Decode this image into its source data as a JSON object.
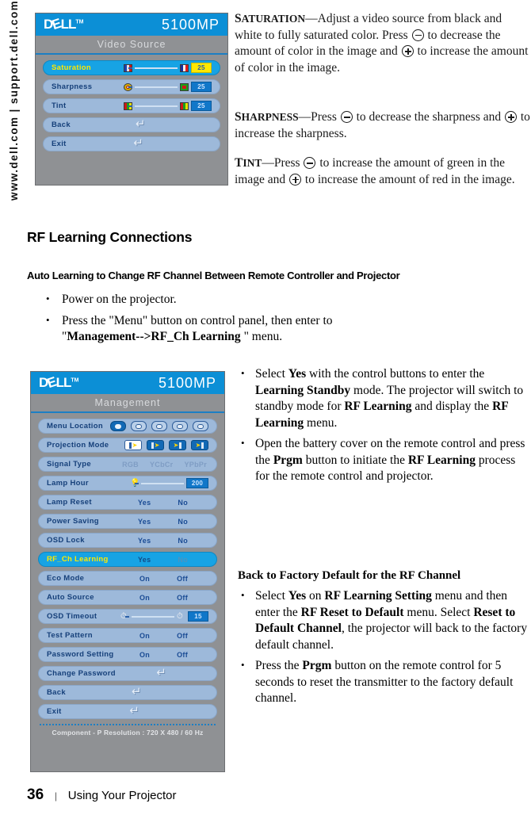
{
  "sidebar": {
    "url_text": "www.dell.com | support.dell.com"
  },
  "video_osd": {
    "brand": "DELL",
    "brand_tm": "TM",
    "model": "5100MP",
    "title": "Video  Source",
    "rows": [
      {
        "label": "Saturation",
        "value": "25",
        "selected": true
      },
      {
        "label": "Sharpness",
        "value": "25",
        "selected": false
      },
      {
        "label": "Tint",
        "value": "25",
        "selected": false
      },
      {
        "label": "Back",
        "selected": false
      },
      {
        "label": "Exit",
        "selected": false
      }
    ]
  },
  "management_osd": {
    "brand": "DELL",
    "brand_tm": "TM",
    "model": "5100MP",
    "title": "Management",
    "rows": [
      {
        "label": "Menu Location"
      },
      {
        "label": "Projection Mode"
      },
      {
        "label": "Signal Type",
        "options": [
          "RGB",
          "YCbCr",
          "YPbPr"
        ]
      },
      {
        "label": "Lamp Hour",
        "value": "200"
      },
      {
        "label": "Lamp Reset",
        "options": [
          "Yes",
          "No"
        ]
      },
      {
        "label": "Power Saving",
        "options": [
          "Yes",
          "No"
        ]
      },
      {
        "label": "OSD Lock",
        "options": [
          "Yes",
          "No"
        ]
      },
      {
        "label": "RF_Ch Learning",
        "options": [
          "Yes",
          "No"
        ],
        "selected": true
      },
      {
        "label": "Eco Mode",
        "options": [
          "On",
          "Off"
        ]
      },
      {
        "label": "Auto Source",
        "options": [
          "On",
          "Off"
        ]
      },
      {
        "label": "OSD Timeout",
        "value": "15"
      },
      {
        "label": "Test Pattern",
        "options": [
          "On",
          "Off"
        ]
      },
      {
        "label": "Password Setting",
        "options": [
          "On",
          "Off"
        ]
      },
      {
        "label": "Change Password"
      },
      {
        "label": "Back"
      },
      {
        "label": "Exit"
      }
    ],
    "status": "Component - P Resolution : 720 X 480 / 60 Hz"
  },
  "text": {
    "saturation_term": "S",
    "saturation_term_rest": "ATURATION",
    "saturation_p1": "—Adjust a video source from black and white to fully saturated color. Press ",
    "saturation_p2": " to decrease the amount of color in the image and ",
    "saturation_p3": " to increase the amount of color in the image.",
    "sharpness_term": "S",
    "sharpness_term_rest": "HARPNESS",
    "sharpness_p1": "—Press ",
    "sharpness_p2": " to decrease the sharpness and ",
    "sharpness_p3": " to increase the sharpness.",
    "tint_term": "T",
    "tint_term_rest": "INT",
    "tint_p1": "—Press ",
    "tint_p2": " to increase the amount of green in the image and ",
    "tint_p3": " to increase the amount of red in the image."
  },
  "section": {
    "heading": "RF Learning Connections",
    "subheading": "Auto Learning to Change RF Channel  Between Remote Controller and Projector",
    "bullets": [
      "Power on the projector.",
      "Press the \"Menu\" button on control panel, then enter to"
    ],
    "bullet2_line2_pre": "\"",
    "bullet2_line2_bold": "Management-->RF_Ch Learning",
    "bullet2_line2_post": " \" menu."
  },
  "right_list": {
    "b1_p1": "Select ",
    "b1_b1": "Yes",
    "b1_p2": " with the control buttons to enter the ",
    "b1_b2": "Learning Standby",
    "b1_p3": " mode. The projector will switch to standby mode for ",
    "b1_b3": "RF Learning",
    "b1_p4": " and display the ",
    "b1_b4": "RF Learning",
    "b1_p5": " menu.",
    "b2_p1": "Open the battery cover on the remote control and press the ",
    "b2_b1": "Prgm",
    "b2_p2": " button to initiate the ",
    "b2_b2": "RF Learning",
    "b2_p3": " process for the remote control and projector.",
    "factory_heading": "Back to Factory Default for the RF Channel",
    "b3_p1": "Select ",
    "b3_b1": "Yes",
    "b3_p2": " on ",
    "b3_b2": "RF Learning Setting",
    "b3_p3": " menu and then enter the ",
    "b3_b3": "RF Reset to Default",
    "b3_p4": " menu. Select ",
    "b3_b4": "Reset to Default Channel",
    "b3_p5": ", the projector will back to the factory default channel.",
    "b4_p1": "Press the ",
    "b4_b1": "Prgm",
    "b4_p2": " button on the remote control for 5 seconds to reset the transmitter to the factory default channel."
  },
  "footer": {
    "page_number": "36",
    "divider": "|",
    "title": "Using Your Projector"
  },
  "colors": {
    "osd_header_blue": "#0c8fd6",
    "osd_body_gray": "#8f9194",
    "row_blue": "#9db9da",
    "row_selected": "#17a3e4",
    "highlight_yellow": "#ffe800"
  }
}
